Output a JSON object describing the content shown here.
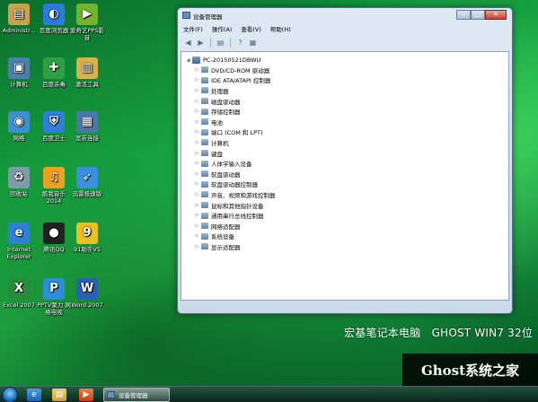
{
  "desktop_icons": [
    {
      "label": "Administr...",
      "icon": "user-folder-icon",
      "color": "#c9a24a",
      "glyph": "▤"
    },
    {
      "label": "百度浏览器",
      "icon": "baidu-browser-icon",
      "color": "#2a7be0",
      "glyph": "◐"
    },
    {
      "label": "爱奇艺PPS影音",
      "icon": "iqiyi-pps-icon",
      "color": "#74b42c",
      "glyph": "▶"
    },
    {
      "label": "计算机",
      "icon": "computer-icon",
      "color": "#4c7fb0",
      "glyph": "▣"
    },
    {
      "label": "百度杀毒",
      "icon": "baidu-antivirus-icon",
      "color": "#2ea043",
      "glyph": "✚"
    },
    {
      "label": "激活工具",
      "icon": "activation-tool-icon",
      "color": "#d9b24a",
      "glyph": "▥"
    },
    {
      "label": "网络",
      "icon": "network-icon",
      "color": "#3f8fd0",
      "glyph": "◉"
    },
    {
      "label": "百度卫士",
      "icon": "baidu-guard-icon",
      "color": "#2f7ed8",
      "glyph": "⛨"
    },
    {
      "label": "宽带连接",
      "icon": "broadband-icon",
      "color": "#4b78a8",
      "glyph": "▦"
    },
    {
      "label": "回收站",
      "icon": "recycle-bin-icon",
      "color": "#7f9aa8",
      "glyph": "♻"
    },
    {
      "label": "酷我音乐2014",
      "icon": "kuwo-music-icon",
      "color": "#f0a020",
      "glyph": "♫"
    },
    {
      "label": "迅雷极速版",
      "icon": "xunlei-icon",
      "color": "#3b8fe0",
      "glyph": "➶"
    },
    {
      "label": "Internet Explorer",
      "icon": "ie-icon",
      "color": "#2f7fd6",
      "glyph": "e"
    },
    {
      "label": "腾讯QQ",
      "icon": "qq-icon",
      "color": "#222222",
      "glyph": "●"
    },
    {
      "label": "91助手V5",
      "icon": "91-assistant-icon",
      "color": "#e8c020",
      "glyph": "9"
    },
    {
      "label": "Excel 2007",
      "icon": "excel-icon",
      "color": "#2a8a3c",
      "glyph": "X"
    },
    {
      "label": "PPTV聚力 网络电视",
      "icon": "pptv-icon",
      "color": "#2a8fd8",
      "glyph": "P"
    },
    {
      "label": "Word 2007",
      "icon": "word-icon",
      "color": "#2a5fb8",
      "glyph": "W"
    }
  ],
  "window": {
    "title": "设备管理器",
    "menu": [
      "文件(F)",
      "操作(A)",
      "查看(V)",
      "帮助(H)"
    ],
    "tree": {
      "root": "PC-20150521DBWU",
      "children": [
        "DVD/CD-ROM 驱动器",
        "IDE ATA/ATAPI 控制器",
        "处理器",
        "磁盘驱动器",
        "存储控制器",
        "电池",
        "端口 (COM 和 LPT)",
        "计算机",
        "键盘",
        "人体学输入设备",
        "软盘驱动器",
        "软盘驱动器控制器",
        "声音、视频和游戏控制器",
        "鼠标和其他指针设备",
        "通用串行总线控制器",
        "网络适配器",
        "系统设备",
        "显示适配器"
      ]
    }
  },
  "brand_text": "宏基笔记本电脑　GHOST WIN7 32位",
  "watermark": "Ghost系统之家",
  "taskbar": {
    "task_label": "设备管理器"
  }
}
